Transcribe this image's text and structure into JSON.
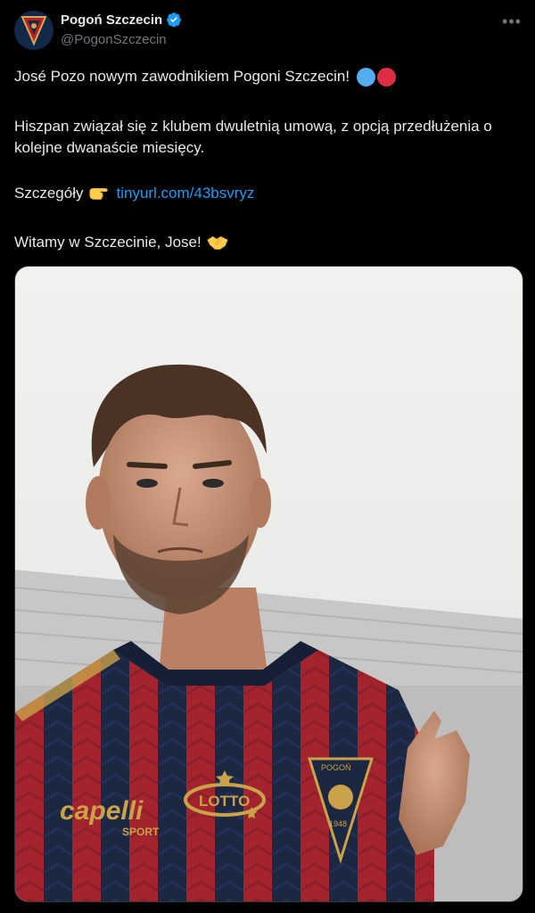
{
  "author": {
    "display_name": "Pogoń Szczecin",
    "handle": "@PogonSzczecin"
  },
  "menu": {
    "more_icon": "three-dots-icon"
  },
  "tweet": {
    "line1": "José Pozo nowym zawodnikiem Pogoni Szczecin!",
    "line2": "Hiszpan związał się z klubem dwuletnią umową, z opcją przedłużenia o kolejne dwanaście miesięcy.",
    "details_label": "Szczegóły",
    "details_emoji": "pointing-right-icon",
    "link_text": "tinyurl.com/43bsvryz",
    "welcome": "Witamy w Szczecinie, Jose!",
    "welcome_emoji": "handshake-icon",
    "dot_colors": [
      "#55acee",
      "#dd2e44"
    ]
  },
  "photo": {
    "kit_sponsor": "capelli",
    "kit_sponsor_sub": "SPORT",
    "shirt_sponsor": "LOTTO",
    "crest_top": "POGOŃ",
    "crest_year": "1948"
  },
  "colors": {
    "accent_link": "#1d9bf0",
    "verified": "#1d9bf0",
    "shirt_red": "#a3242e",
    "shirt_navy": "#1c2742",
    "gold": "#c9a24a"
  }
}
